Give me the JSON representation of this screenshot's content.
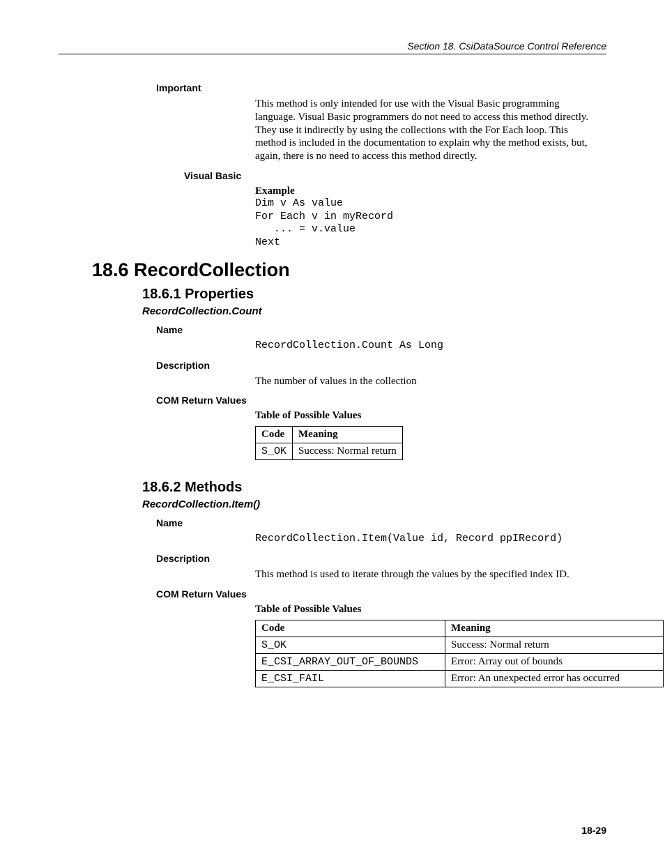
{
  "running_head": "Section 18.  CsiDataSource Control Reference",
  "important": {
    "label": "Important",
    "text": "This method is only intended for use with the Visual Basic programming language.  Visual Basic programmers do not need to access this method directly.  They use it indirectly by using the collections with the For Each loop.  This method is included in the documentation to explain why the method exists, but, again, there is no need to access this method directly."
  },
  "vb": {
    "label": "Visual Basic",
    "example_label": "Example",
    "code": "Dim v As value\nFor Each v in myRecord\n   ... = v.value\nNext"
  },
  "h_recordcollection": "18.6  RecordCollection",
  "h_properties": "18.6.1  Properties",
  "prop_count": {
    "member": "RecordCollection.Count",
    "name_label": "Name",
    "name_code": "RecordCollection.Count As Long",
    "desc_label": "Description",
    "desc_text": "The number of values in the collection",
    "com_label": "COM Return Values",
    "table_caption": "Table of Possible Values",
    "th_code": "Code",
    "th_meaning": "Meaning",
    "rows": [
      {
        "code": "S_OK",
        "meaning": "Success: Normal return"
      }
    ]
  },
  "h_methods": "18.6.2  Methods",
  "meth_item": {
    "member": "RecordCollection.Item()",
    "name_label": "Name",
    "name_code": "RecordCollection.Item(Value id, Record ppIRecord)",
    "desc_label": "Description",
    "desc_text": "This method is used to iterate through the values by the specified index ID.",
    "com_label": "COM Return Values",
    "table_caption": "Table of Possible Values",
    "th_code": "Code",
    "th_meaning": "Meaning",
    "rows": [
      {
        "code": "S_OK",
        "meaning": "Success: Normal return"
      },
      {
        "code": "E_CSI_ARRAY_OUT_OF_BOUNDS",
        "meaning": "Error: Array out of bounds"
      },
      {
        "code": "E_CSI_FAIL",
        "meaning": "Error: An unexpected error has occurred"
      }
    ]
  },
  "page_number": "18-29"
}
